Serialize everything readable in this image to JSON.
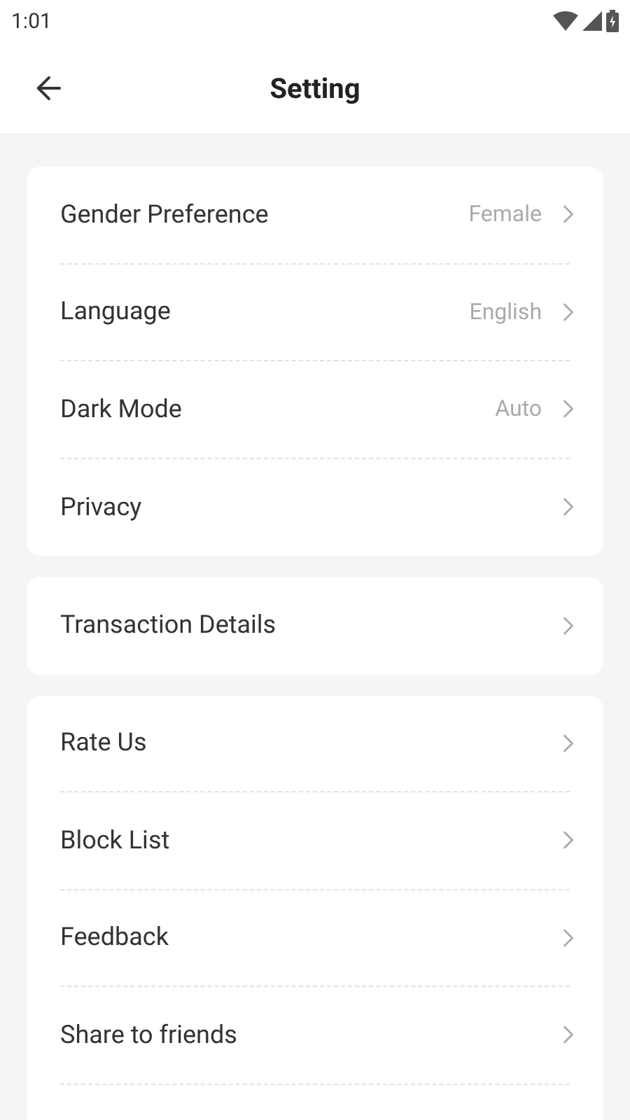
{
  "status_bar": {
    "time": "1:01"
  },
  "header": {
    "title": "Setting"
  },
  "groups": [
    {
      "items": [
        {
          "label": "Gender Preference",
          "value": "Female"
        },
        {
          "label": "Language",
          "value": "English"
        },
        {
          "label": "Dark Mode",
          "value": "Auto"
        },
        {
          "label": "Privacy"
        }
      ]
    },
    {
      "items": [
        {
          "label": "Transaction Details"
        }
      ]
    },
    {
      "items": [
        {
          "label": "Rate Us"
        },
        {
          "label": "Block List"
        },
        {
          "label": "Feedback"
        },
        {
          "label": "Share to friends"
        }
      ]
    }
  ]
}
